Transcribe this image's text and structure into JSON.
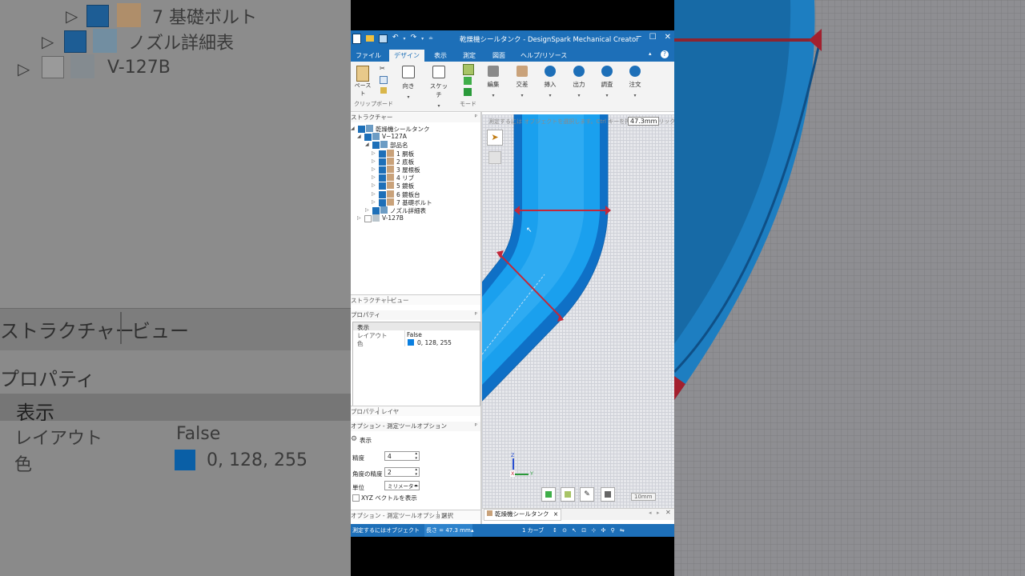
{
  "window": {
    "title": "乾燥機シールタンク - DesignSpark  Mechanical  Creator",
    "help_label": "?"
  },
  "tabs": [
    "ファイル",
    "デザイン",
    "表示",
    "測定",
    "図面",
    "ヘルプ/リソース"
  ],
  "ribbon": {
    "paste": "ペースト",
    "clipboard_group": "クリップボード",
    "orient": "向き",
    "sketch": "スケッチ",
    "mode_group": "モード",
    "edit": "編集",
    "intersect": "交差",
    "insert": "挿入",
    "output": "出力",
    "inspect": "調査",
    "order": "注文"
  },
  "structure": {
    "header": "ストラクチャー",
    "pin": "ᵖ",
    "items": [
      {
        "label": "乾燥機シールタンク",
        "level": 0,
        "checked": true
      },
      {
        "label": "V−127A",
        "level": 1,
        "checked": true
      },
      {
        "label": "部品名",
        "level": 2,
        "checked": true
      },
      {
        "label": "1 胴板",
        "level": 3,
        "checked": true
      },
      {
        "label": "2 底板",
        "level": 3,
        "checked": true
      },
      {
        "label": "3 屋根板",
        "level": 3,
        "checked": true
      },
      {
        "label": "4 リブ",
        "level": 3,
        "checked": true
      },
      {
        "label": "5 鏡板",
        "level": 3,
        "checked": true
      },
      {
        "label": "6 鏡板台",
        "level": 3,
        "checked": true
      },
      {
        "label": "7 基礎ボルト",
        "level": 3,
        "checked": true
      },
      {
        "label": "ノズル詳細表",
        "level": 2,
        "checked": true
      },
      {
        "label": "V-127B",
        "level": 1,
        "checked": false
      }
    ],
    "bottom_tabs": [
      "ストラクチャー",
      "ビュー"
    ]
  },
  "properties": {
    "header": "プロパティ",
    "group": "表示",
    "rows": [
      {
        "name": "レイアウト",
        "value": "False"
      },
      {
        "name": "色",
        "value": "0, 128, 255",
        "swatch": "#0a7fe0"
      }
    ],
    "bottom_tabs": [
      "プロパティ",
      "レイヤ"
    ]
  },
  "options": {
    "header": "オプション - 測定ツールオプション",
    "group": "表示",
    "precision_label": "精度",
    "precision_value": "4",
    "angle_label": "角度の精度",
    "angle_value": "2",
    "unit_label": "単位",
    "unit_value": "ミリメーター",
    "xyz_label": "XYZ ベクトルを表示",
    "bottom_tabs": [
      "オプション - 測定ツールオプション",
      "選択"
    ]
  },
  "viewport": {
    "hint": "測定するには オブジェクトを選択します。Ctrl キーを押しながらクリックして、",
    "measurement": "47.3mm",
    "scale": "10mm",
    "axis_z": "Z",
    "axis_y": "Y",
    "axis_x": "X"
  },
  "doc_tab": {
    "label": "乾燥機シールタンク",
    "close": "×"
  },
  "statusbar": {
    "left": "測定するにはオブジェクト",
    "length": "長さ = 47.3 mm",
    "selection": "1 カーブ"
  },
  "background": {
    "items": [
      "7 基礎ボルト",
      "ノズル詳細表",
      "V-127B"
    ],
    "tabs": [
      "ストラクチャー",
      "ビュー"
    ],
    "prop_header": "プロパティ",
    "group": "表示",
    "layout_label": "レイアウト",
    "layout_value": "False",
    "color_label": "色",
    "color_value": "0, 128, 255"
  },
  "colors": {
    "accent": "#1d6fb8",
    "pipe": "#1aa0ee",
    "measure_line": "#c2283a"
  }
}
